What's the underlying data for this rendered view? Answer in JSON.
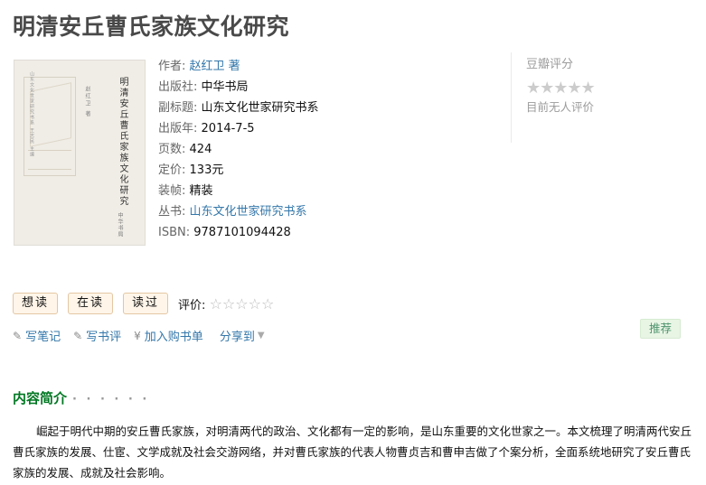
{
  "book": {
    "title": "明清安丘曹氏家族文化研究"
  },
  "cover": {
    "vertical_title": "明清安丘曹氏家族文化研究",
    "vertical_author": "赵红卫 著",
    "side_text": "山东文化世家研究书系 王志民 主编",
    "publisher_mark": "中华书局"
  },
  "info": {
    "author_label": "作者:",
    "author": "赵红卫 著",
    "publisher_label": "出版社:",
    "publisher": "中华书局",
    "subtitle_label": "副标题:",
    "subtitle": "山东文化世家研究书系",
    "pubdate_label": "出版年:",
    "pubdate": "2014-7-5",
    "pages_label": "页数:",
    "pages": "424",
    "price_label": "定价:",
    "price": "133元",
    "binding_label": "装帧:",
    "binding": "精装",
    "series_label": "丛书:",
    "series": "山东文化世家研究书系",
    "isbn_label": "ISBN:",
    "isbn": "9787101094428"
  },
  "rating": {
    "label": "豆瓣评分",
    "stars": "★★★★★",
    "none_text": "目前无人评价"
  },
  "actions": {
    "want": "想读",
    "reading": "在读",
    "read": "读过",
    "rate_label": "评价:",
    "rate_stars": "☆☆☆☆☆"
  },
  "links": {
    "note": "写笔记",
    "review": "写书评",
    "cart": "加入购书单",
    "share": "分享到",
    "note_icon": "pencil-icon",
    "review_icon": "pencil-icon",
    "cart_icon": "yen-icon"
  },
  "recommend": "推荐",
  "intro": {
    "heading": "内容简介",
    "dots": "· · · · · ·",
    "text": "崛起于明代中期的安丘曹氏家族，对明清两代的政治、文化都有一定的影响，是山东重要的文化世家之一。本文梳理了明清两代安丘曹氏家族的发展、仕宦、文学成就及社会交游网络，并对曹氏家族的代表人物曹贞吉和曹申吉做了个案分析，全面系统地研究了安丘曹氏家族的发展、成就及社会影响。"
  }
}
